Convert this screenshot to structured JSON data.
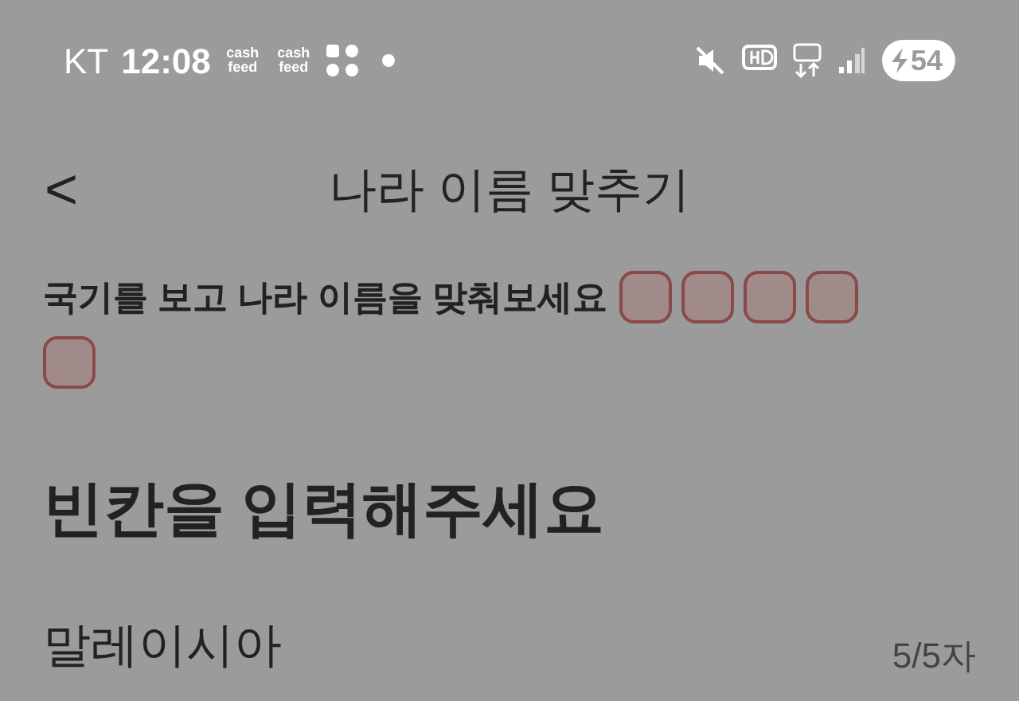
{
  "status_bar": {
    "carrier": "KT",
    "time": "12:08",
    "app_badges": [
      "cash feed",
      "cash feed"
    ],
    "battery": "54"
  },
  "header": {
    "back": "<",
    "title": "나라 이름 맞추기"
  },
  "instruction": "국기를 보고 나라 이름을 맞춰보세요",
  "slots": [
    {
      "filled": false
    },
    {
      "filled": false
    },
    {
      "filled": false
    },
    {
      "filled": false
    },
    {
      "filled": false
    }
  ],
  "heading": "빈칸을 입력해주세요",
  "answer": {
    "value": "말레이시아",
    "counter": "5/5자"
  }
}
